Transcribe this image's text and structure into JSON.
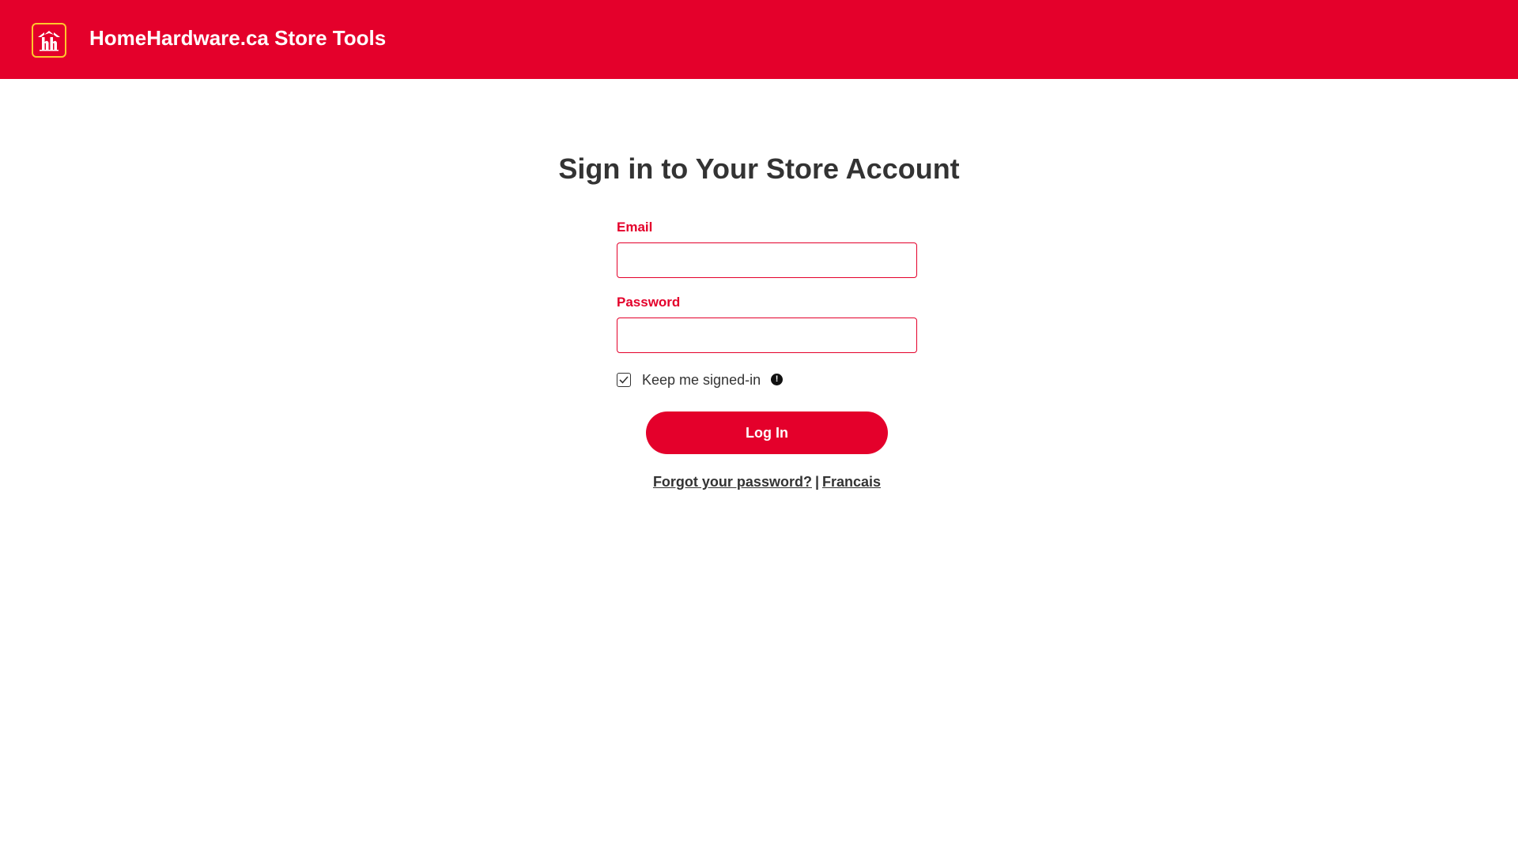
{
  "header": {
    "brand_title": "HomeHardware.ca Store Tools",
    "logo_icon": "home-hardware-logo",
    "background_color": "#e4002b",
    "logo_border_color": "#ffc72c"
  },
  "main": {
    "title": "Sign in to Your Store Account"
  },
  "form": {
    "email_label": "Email",
    "email_value": "",
    "password_label": "Password",
    "password_value": "",
    "remember_label": "Keep me signed-in",
    "remember_checked": true,
    "info_icon": "info-icon",
    "info_glyph": "!",
    "login_button": "Log In",
    "forgot_link": "Forgot your password?",
    "separator": "|",
    "language_link": "Francais",
    "accent_color": "#e4002b"
  }
}
